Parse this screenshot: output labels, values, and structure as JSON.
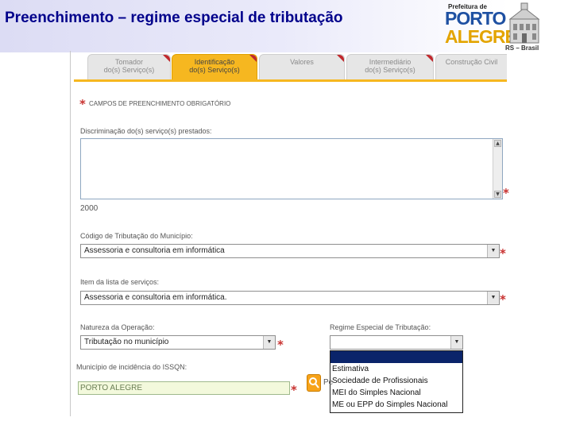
{
  "slide": {
    "title": "Preenchimento – regime especial de tributação",
    "logo_small": "Prefeitura de",
    "logo_porto": "PORTO",
    "logo_alegre": "ALEGRE",
    "logo_region": "RS – Brasil",
    "colors": {
      "title": "#00008b",
      "tab_active": "#f6b720",
      "required": "#c8312f"
    }
  },
  "tabs": [
    {
      "line1": "Tomador",
      "line2": "do(s) Serviço(s)",
      "active": false
    },
    {
      "line1": "Identificação",
      "line2": "do(s) Serviço(s)",
      "active": true
    },
    {
      "line1": "Valores",
      "line2": "",
      "active": false
    },
    {
      "line1": "Intermediário",
      "line2": "do(s) Serviço(s)",
      "active": false
    },
    {
      "line1": "Construção Civil",
      "line2": "",
      "active": false
    }
  ],
  "form": {
    "required_note": "CAMPOS DE PREENCHIMENTO OBRIGATÓRIO",
    "discriminacao_label": "Discriminação do(s) serviço(s) prestados:",
    "discriminacao_value": "",
    "char_limit": "2000",
    "codigo_label": "Código de Tributação do Município:",
    "codigo_value": "Assessoria e consultoria em informática",
    "item_label": "Item da lista de serviços:",
    "item_value": "Assessoria e consultoria em informática.",
    "natureza_label": "Natureza da Operação:",
    "natureza_value": "Tributação no município",
    "regime_label": "Regime Especial de Tributação:",
    "regime_value": "",
    "regime_options": [
      "",
      "Estimativa",
      "Sociedade de Profissionais",
      "MEI do Simples Nacional",
      "ME ou EPP do Simples Nacional"
    ],
    "municipio_label": "Município de incidência do ISSQN:",
    "municipio_value": "PORTO ALEGRE",
    "search_label_fragment": "Pe"
  },
  "icons": {
    "required": "asterisk-icon",
    "search": "magnifier-icon",
    "dropdown": "chevron-down-icon",
    "scroll_up": "triangle-up-icon",
    "scroll_down": "triangle-down-icon"
  }
}
